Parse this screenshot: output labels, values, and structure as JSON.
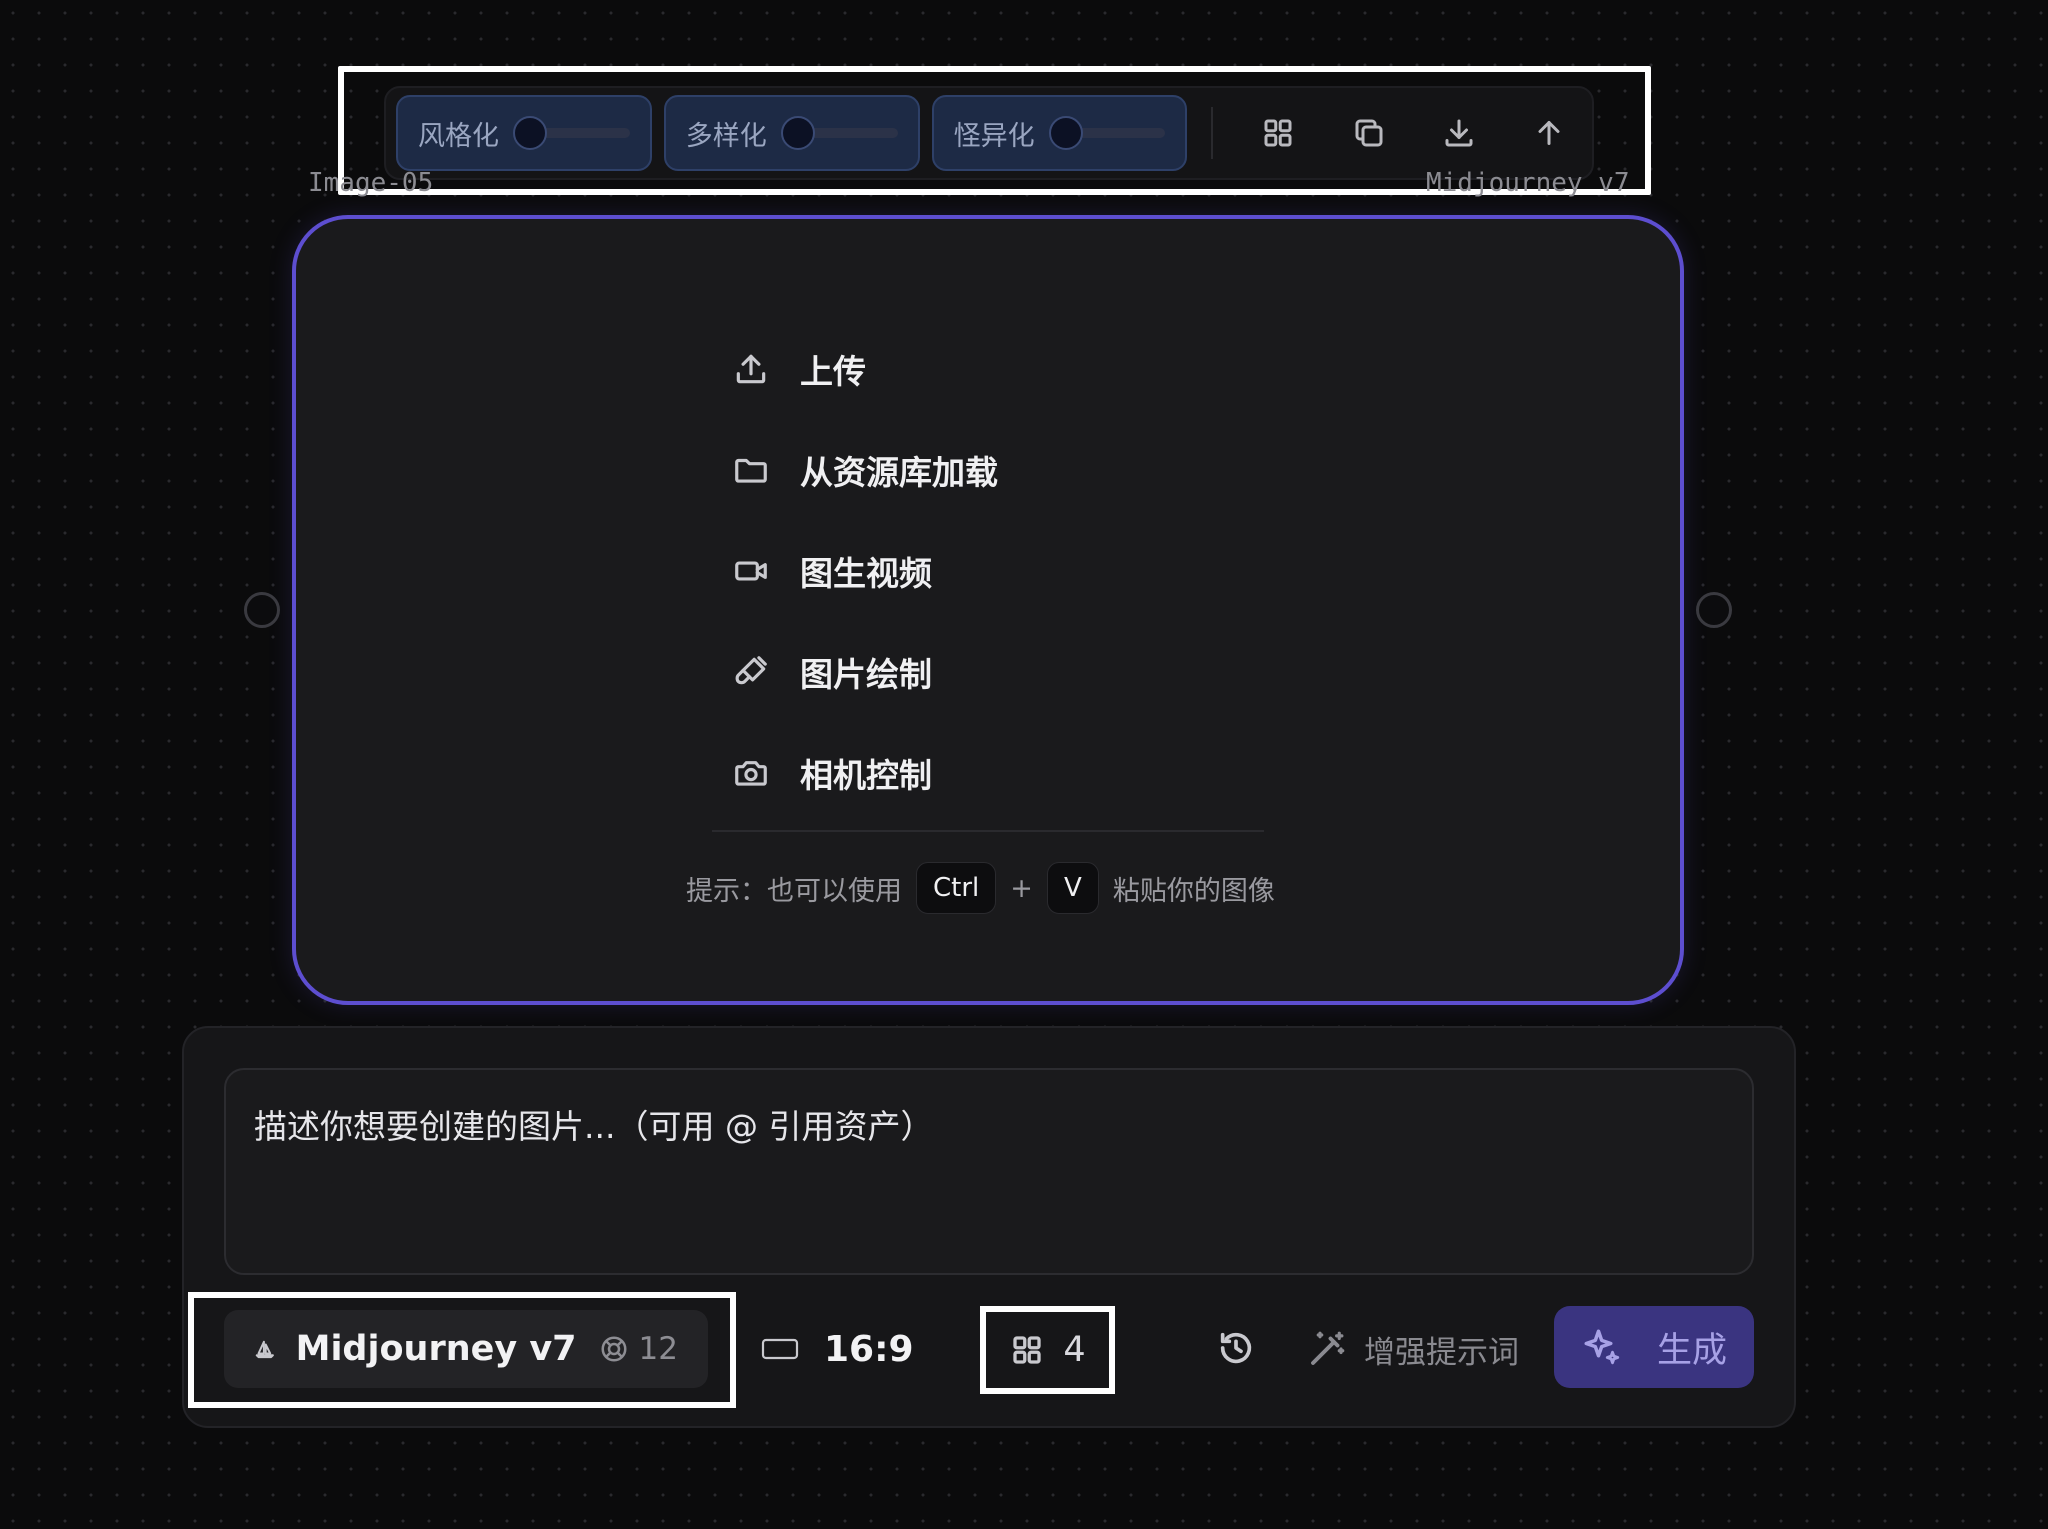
{
  "toolbar": {
    "sliders": [
      {
        "label": "风格化",
        "value": 0
      },
      {
        "label": "多样化",
        "value": 0
      },
      {
        "label": "怪异化",
        "value": 0
      }
    ],
    "icons": [
      "grid-icon",
      "copy-icon",
      "download-icon",
      "arrow-up-icon"
    ]
  },
  "node": {
    "label_left": "Image-05",
    "label_right": "Midjourney v7",
    "menu": [
      {
        "icon": "upload-icon",
        "label": "上传"
      },
      {
        "icon": "folder-icon",
        "label": "从资源库加载"
      },
      {
        "icon": "video-camera-icon",
        "label": "图生视频"
      },
      {
        "icon": "brush-icon",
        "label": "图片绘制"
      },
      {
        "icon": "camera-icon",
        "label": "相机控制"
      }
    ],
    "hint": {
      "prefix": "提示：也可以使用",
      "key1": "Ctrl",
      "plus": "+",
      "key2": "V",
      "suffix": "粘贴你的图像"
    }
  },
  "prompt": {
    "placeholder": "描述你想要创建的图片...（可用 @ 引用资产）",
    "model": {
      "name": "Midjourney v7",
      "cost": "12"
    },
    "aspect_ratio": "16:9",
    "image_count": "4",
    "enhance_label": "增强提示词",
    "generate_label": "生成"
  },
  "colors": {
    "accent": "#5d4ed0",
    "generate_bg": "#3a3480",
    "slider_bg": "#1d2a45"
  }
}
